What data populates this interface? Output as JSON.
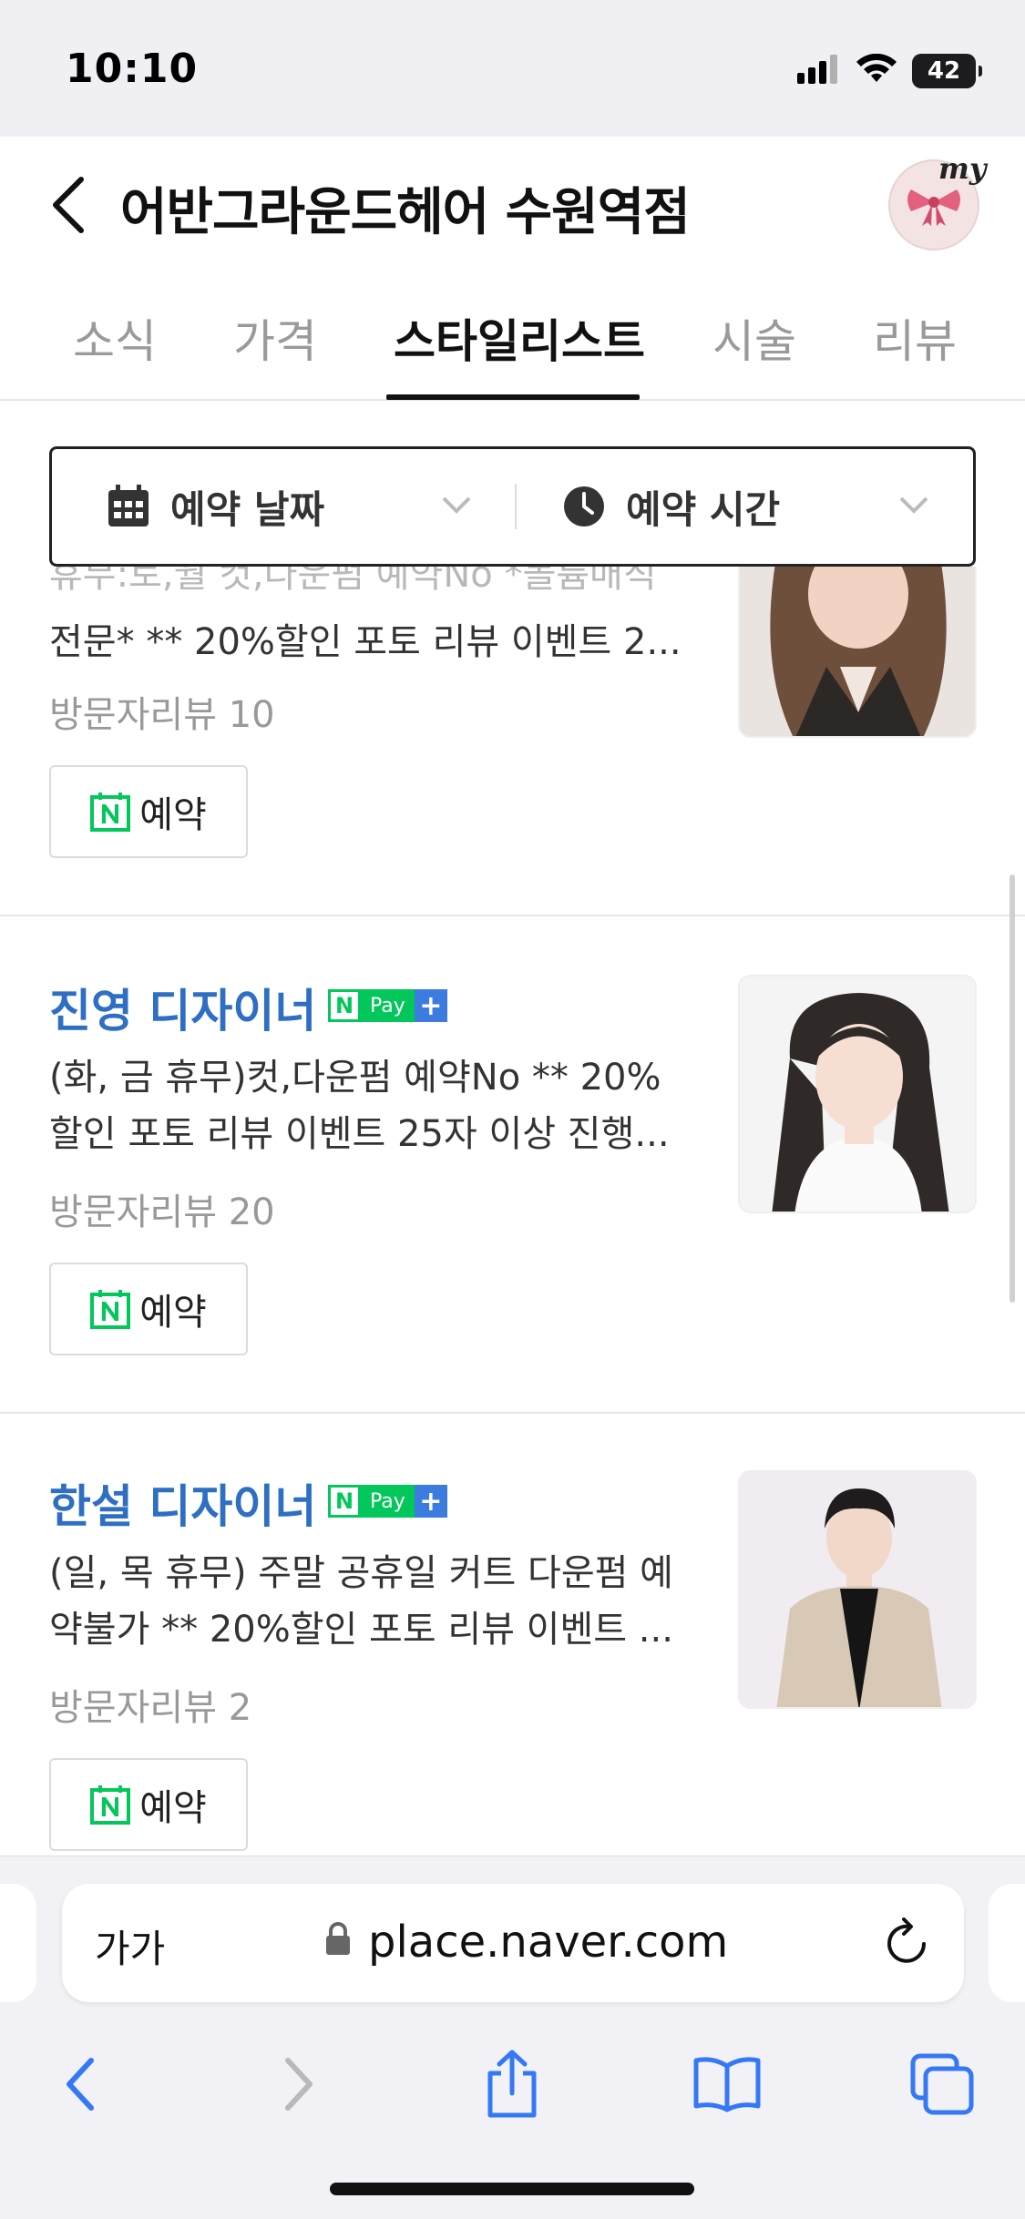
{
  "status_bar": {
    "time": "10:10",
    "battery": "42"
  },
  "header": {
    "title": "어반그라운드헤어 수원역점",
    "my_label": "my"
  },
  "tabs": [
    {
      "label": "소식"
    },
    {
      "label": "가격"
    },
    {
      "label": "스타일리스트"
    },
    {
      "label": "시술"
    },
    {
      "label": "리뷰"
    }
  ],
  "filters": {
    "date_label": "예약 날짜",
    "time_label": "예약 시간"
  },
  "designers": [
    {
      "name": "",
      "partial_top": "휴무:토,월 컷,다운펌 예약No *볼륨매직",
      "description": "전문* ** 20%할인 포토 리뷰 이벤트 2...",
      "reviews": "방문자리뷰 10",
      "reserve_label": "예약"
    },
    {
      "name": "진영 디자이너",
      "pay_label": "Pay",
      "description": "(화, 금 휴무)컷,다운펌 예약No ** 20% 할인 포토 리뷰 이벤트 25자 이상 진행...",
      "reviews": "방문자리뷰 20",
      "reserve_label": "예약"
    },
    {
      "name": "한설 디자이너",
      "pay_label": "Pay",
      "description": "(일, 목 휴무) 주말 공휴일 커트 다운펌 예약불가 ** 20%할인 포토 리뷰 이벤트 ...",
      "reviews": "방문자리뷰 2",
      "reserve_label": "예약"
    }
  ],
  "browser": {
    "text_size_label": "가가",
    "url": "place.naver.com"
  },
  "colors": {
    "naver_green": "#03c75a",
    "link_blue": "#2e6fc4",
    "ios_blue": "#3478f6"
  }
}
